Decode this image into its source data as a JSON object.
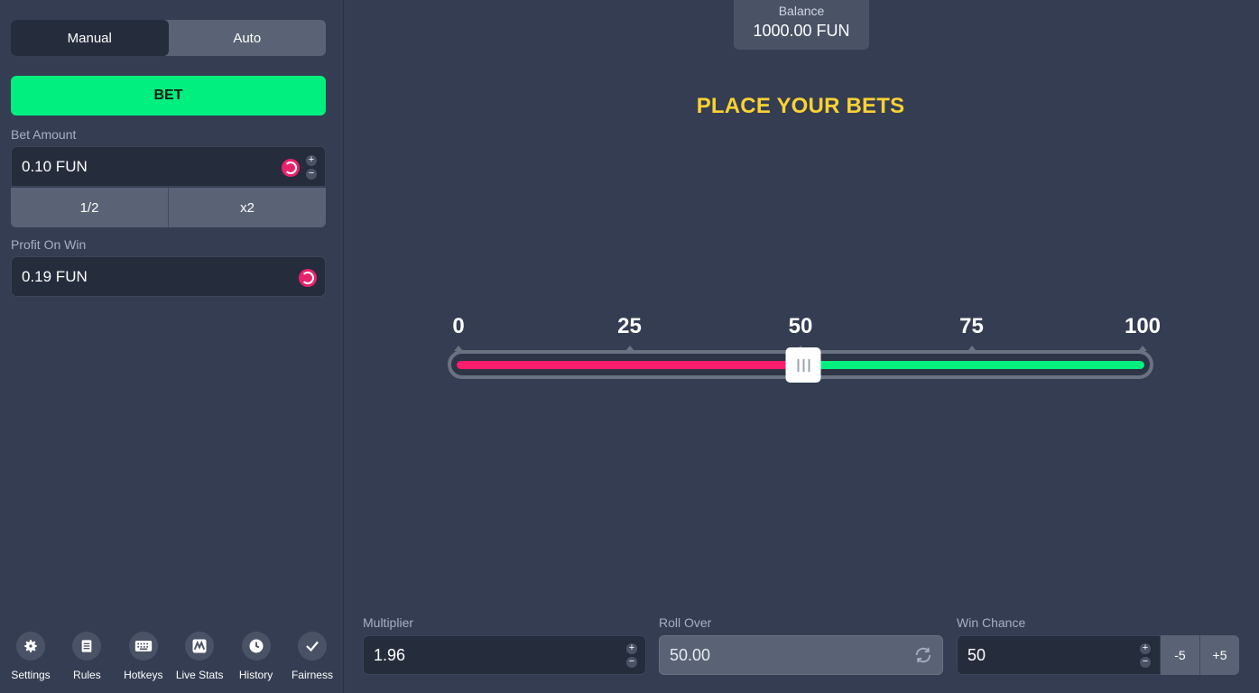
{
  "sidebar": {
    "mode_tabs": [
      {
        "label": "Manual",
        "active": true
      },
      {
        "label": "Auto",
        "active": false
      }
    ],
    "bet_button_label": "BET",
    "bet_amount": {
      "label": "Bet Amount",
      "value": "0.10 FUN",
      "currency_icon": "coin-icon"
    },
    "quick_buttons": [
      {
        "label": "1/2"
      },
      {
        "label": "x2"
      }
    ],
    "profit_on_win": {
      "label": "Profit On Win",
      "value": "0.19 FUN",
      "currency_icon": "coin-icon"
    },
    "footer_nav": [
      {
        "label": "Settings",
        "icon": "gear-icon"
      },
      {
        "label": "Rules",
        "icon": "document-icon"
      },
      {
        "label": "Hotkeys",
        "icon": "keyboard-icon"
      },
      {
        "label": "Live Stats",
        "icon": "chart-icon"
      },
      {
        "label": "History",
        "icon": "clock-icon"
      },
      {
        "label": "Fairness",
        "icon": "check-icon"
      }
    ]
  },
  "balance": {
    "label": "Balance",
    "value": "1000.00 FUN"
  },
  "headline": "PLACE YOUR BETS",
  "slider": {
    "scale_labels": [
      "0",
      "25",
      "50",
      "75",
      "100"
    ],
    "min": 0,
    "max": 100,
    "value": 50,
    "lose_color": "#fa1d6b",
    "win_color": "#00ef7f"
  },
  "controls": {
    "multiplier": {
      "label": "Multiplier",
      "value": "1.96"
    },
    "roll_over": {
      "label": "Roll Over",
      "value": "50.00",
      "icon": "refresh-icon"
    },
    "win_chance": {
      "label": "Win Chance",
      "value": "50",
      "minus_label": "-5",
      "plus_label": "+5"
    }
  },
  "colors": {
    "accent_green": "#00ef7f",
    "accent_pink": "#fa1d6b",
    "headline_yellow": "#fcd232",
    "background": "#343d52"
  }
}
